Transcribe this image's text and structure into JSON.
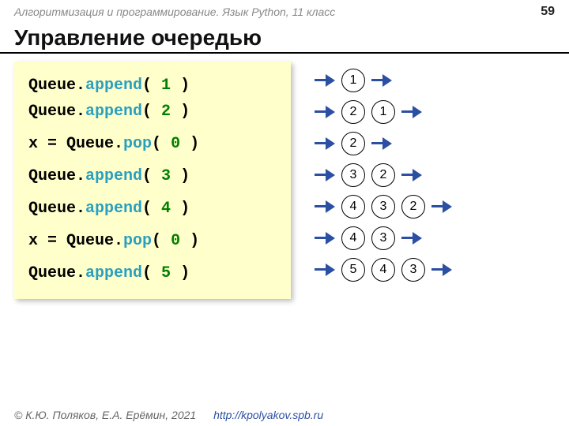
{
  "header": {
    "course": "Алгоритмизация и программирование. Язык Python, 11 класс",
    "page": "59"
  },
  "title": "Управление очередью",
  "code": {
    "lines": [
      {
        "type": "append",
        "obj": "Queue",
        "method": "append",
        "arg": "1"
      },
      {
        "type": "append",
        "obj": "Queue",
        "method": "append",
        "arg": "2"
      },
      {
        "type": "gap"
      },
      {
        "type": "pop",
        "lhs": "x = ",
        "obj": "Queue",
        "method": "pop",
        "arg": "0"
      },
      {
        "type": "gap"
      },
      {
        "type": "append",
        "obj": "Queue",
        "method": "append",
        "arg": "3"
      },
      {
        "type": "gap"
      },
      {
        "type": "append",
        "obj": "Queue",
        "method": "append",
        "arg": "4"
      },
      {
        "type": "gap"
      },
      {
        "type": "pop",
        "lhs": "x = ",
        "obj": "Queue",
        "method": "pop",
        "arg": "0"
      },
      {
        "type": "gap"
      },
      {
        "type": "append",
        "obj": "Queue",
        "method": "append",
        "arg": "5"
      }
    ]
  },
  "queues": [
    {
      "in": true,
      "items": [
        "1"
      ],
      "out": true
    },
    {
      "in": true,
      "items": [
        "2",
        "1"
      ],
      "out": true
    },
    {
      "in": true,
      "items": [
        "2"
      ],
      "out": true
    },
    {
      "in": true,
      "items": [
        "3",
        "2"
      ],
      "out": true
    },
    {
      "in": true,
      "items": [
        "4",
        "3",
        "2"
      ],
      "out": true
    },
    {
      "in": true,
      "items": [
        "4",
        "3"
      ],
      "out": true
    },
    {
      "in": true,
      "items": [
        "5",
        "4",
        "3"
      ],
      "out": true
    }
  ],
  "footer": {
    "copyright": "© К.Ю. Поляков, Е.А. Ерёмин, 2021",
    "url": "http://kpolyakov.spb.ru"
  }
}
